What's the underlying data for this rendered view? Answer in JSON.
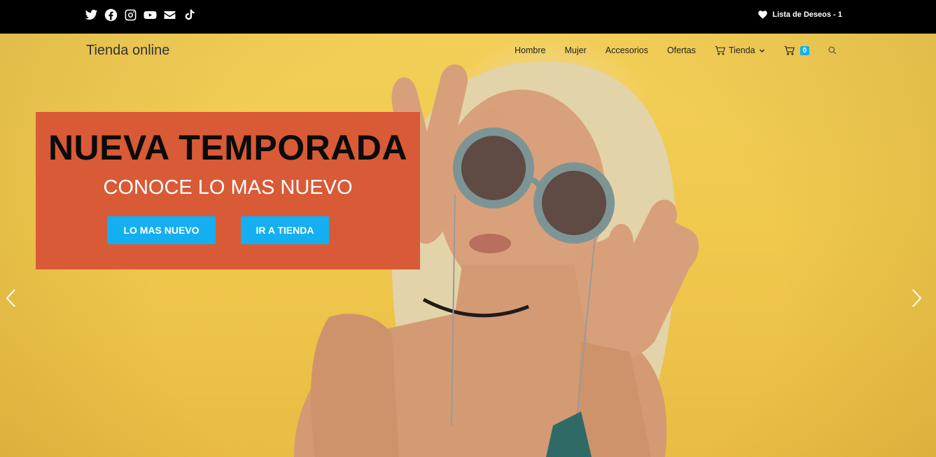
{
  "topbar": {
    "social_icons": [
      "twitter-icon",
      "facebook-icon",
      "instagram-icon",
      "youtube-icon",
      "envelope-icon",
      "tiktok-icon"
    ],
    "wishlist_label": "Lista de Deseos - 1"
  },
  "header": {
    "brand": "Tienda online",
    "nav": {
      "hombre": "Hombre",
      "mujer": "Mujer",
      "accesorios": "Accesorios",
      "ofertas": "Ofertas",
      "tienda": "Tienda"
    },
    "cart_count": "0"
  },
  "hero": {
    "title": "NUEVA TEMPORADA",
    "subtitle": "CONOCE LO MAS NUEVO",
    "button_primary": "LO MAS NUEVO",
    "button_secondary": "IR A TIENDA"
  },
  "colors": {
    "topbar": "#000000",
    "accent": "#13aff0",
    "promo_box": "#d95a36",
    "background": "#f2c94a"
  }
}
